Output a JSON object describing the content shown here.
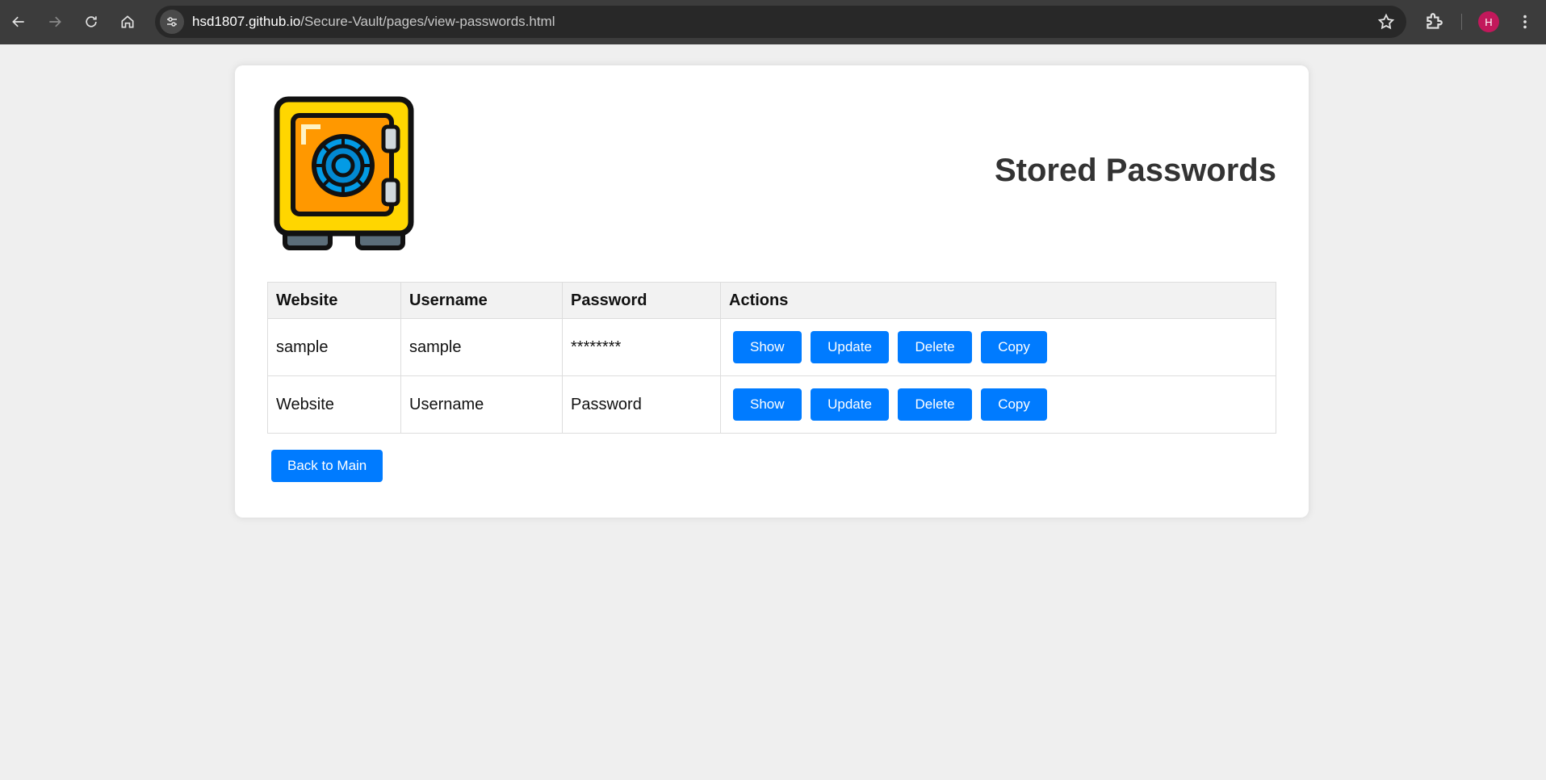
{
  "browser": {
    "url_host": "hsd1807.github.io",
    "url_path": "/Secure-Vault/pages/view-passwords.html",
    "profile_initial": "H"
  },
  "page": {
    "title": "Stored Passwords",
    "logo_icon": "safe-vault-icon"
  },
  "table": {
    "headers": [
      "Website",
      "Username",
      "Password",
      "Actions"
    ],
    "rows": [
      {
        "website": "sample",
        "username": "sample",
        "password": "********"
      },
      {
        "website": "Website",
        "username": "Username",
        "password": "Password"
      }
    ],
    "action_labels": {
      "show": "Show",
      "update": "Update",
      "delete": "Delete",
      "copy": "Copy"
    }
  },
  "back_button": "Back to Main",
  "colors": {
    "accent": "#007bff",
    "page_bg": "#efefef",
    "avatar": "#c2185b"
  }
}
